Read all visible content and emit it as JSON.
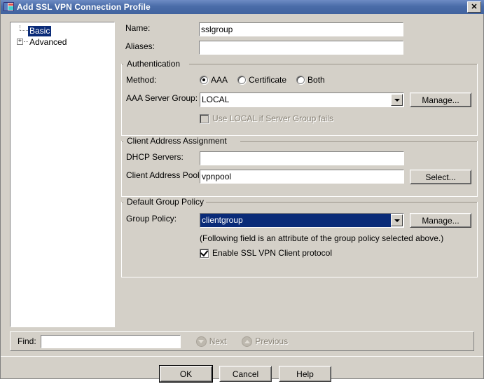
{
  "window": {
    "title": "Add SSL VPN Connection Profile",
    "icon": "profile-window-icon",
    "close_label": "✕"
  },
  "tree": {
    "items": [
      {
        "label": "Basic",
        "selected": true,
        "expandable": false
      },
      {
        "label": "Advanced",
        "selected": false,
        "expandable": true,
        "expander": "+"
      }
    ]
  },
  "form": {
    "name": {
      "label": "Name:",
      "value": "sslgroup",
      "placeholder": ""
    },
    "aliases": {
      "label": "Aliases:",
      "value": "",
      "placeholder": ""
    }
  },
  "authentication": {
    "title": "Authentication",
    "method": {
      "label": "Method:",
      "options": [
        {
          "label": "AAA",
          "selected": true
        },
        {
          "label": "Certificate",
          "selected": false
        },
        {
          "label": "Both",
          "selected": false
        }
      ]
    },
    "server_group": {
      "label": "AAA Server Group:",
      "value": "LOCAL",
      "manage_label": "Manage..."
    },
    "use_local": {
      "label": "Use LOCAL if Server Group fails",
      "checked": false,
      "enabled": false
    }
  },
  "client_address": {
    "title": "Client Address Assignment",
    "dhcp_servers": {
      "label": "DHCP Servers:",
      "value": "",
      "placeholder": ""
    },
    "address_pools": {
      "label": "Client Address Pools:",
      "value": "vpnpool",
      "select_label": "Select..."
    }
  },
  "default_group_policy": {
    "title": "Default Group Policy",
    "group_policy": {
      "label": "Group Policy:",
      "value": "clientgroup",
      "manage_label": "Manage...",
      "highlighted": true
    },
    "note": "(Following field is an attribute of the group policy selected above.)",
    "enable_ssl_vpn": {
      "label": "Enable SSL VPN Client protocol",
      "checked": true,
      "enabled": true
    }
  },
  "findbar": {
    "label": "Find:",
    "value": "",
    "placeholder": "",
    "next_label": "Next",
    "previous_label": "Previous",
    "next_enabled": false,
    "previous_enabled": false
  },
  "buttons": {
    "ok": "OK",
    "cancel": "Cancel",
    "help": "Help"
  },
  "colors": {
    "titlebar": "#4a6ca8",
    "dialog_face": "#d4d0c8",
    "selection": "#0a2b78",
    "disabled_text": "#878175"
  }
}
